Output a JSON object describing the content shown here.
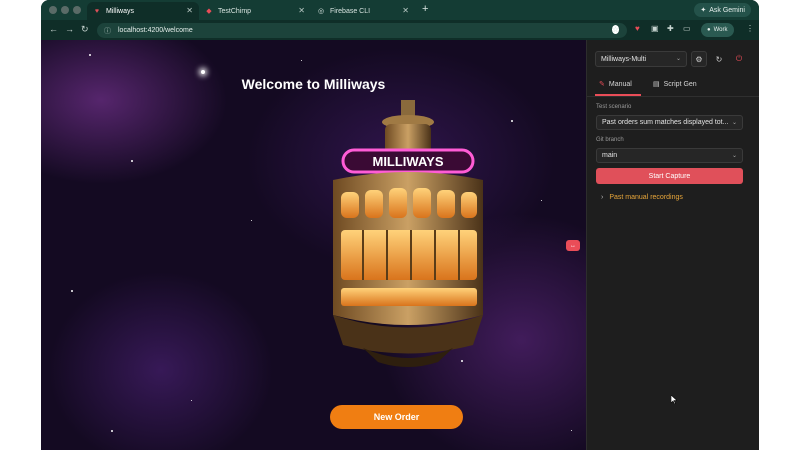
{
  "browser": {
    "tabs": [
      {
        "label": "Milliways",
        "active": true
      },
      {
        "label": "TestChimp",
        "active": false
      },
      {
        "label": "Firebase CLI",
        "active": false
      }
    ],
    "new_tab": "+",
    "ask_label": "Ask Gemini",
    "url": "localhost:4200/welcome",
    "profile_label": "Work"
  },
  "page": {
    "title": "Welcome to Milliways",
    "sign_text": "MILLIWAYS",
    "order_button": "New Order",
    "handle_label": "↔"
  },
  "panel": {
    "project": "Milliways-Multi",
    "tabs": [
      {
        "label": "Manual",
        "active": true
      },
      {
        "label": "Script Gen",
        "active": false
      }
    ],
    "scenario_label": "Test scenario",
    "scenario_value": "Past orders sum matches displayed tot...",
    "branch_label": "Git branch",
    "branch_value": "main",
    "capture_button": "Start Capture",
    "past_recordings": "Past manual recordings"
  },
  "colors": {
    "accent": "#e0505a",
    "order": "#f07e12",
    "browser_frame": "#0f2e28",
    "past_link": "#e8a63a"
  }
}
